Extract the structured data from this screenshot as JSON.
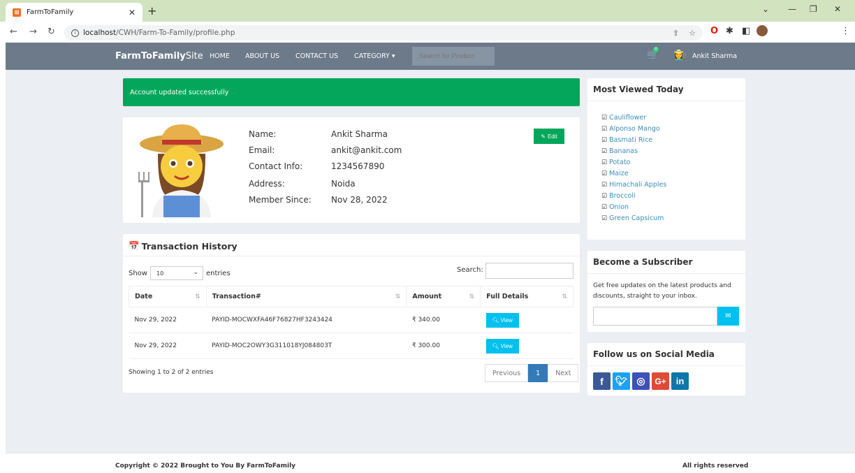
{
  "browser": {
    "tab_title": "FarmToFamily",
    "url_host": "localhost",
    "url_path": "/CWH/Farm-To-Family/profile.php"
  },
  "nav": {
    "brand_bold": "FarmToFamily",
    "brand_rest": "Site",
    "links": [
      "HOME",
      "ABOUT US",
      "CONTACT US",
      "CATEGORY ▾"
    ],
    "search_placeholder": "Search for Product",
    "cart_count": "0",
    "user_name": "Ankit Sharma"
  },
  "alert": "Account updated successfully",
  "profile": {
    "labels": [
      "Name:",
      "Email:",
      "Contact Info:",
      "Address:",
      "Member Since:"
    ],
    "values": [
      "Ankit Sharma",
      "ankit@ankit.com",
      "1234567890",
      "Noida",
      "Nov 28, 2022"
    ],
    "edit_label": "Edit"
  },
  "transactions": {
    "title": "Transaction History",
    "show_label": "Show",
    "entries_value": "10",
    "entries_label": "entries",
    "search_label": "Search:",
    "headers": [
      "Date",
      "Transaction#",
      "Amount",
      "Full Details"
    ],
    "rows": [
      {
        "date": "Nov 29, 2022",
        "id": "PAYID-MOCWXFA46F76827HF3243424",
        "amount": "₹ 340.00",
        "action": "View"
      },
      {
        "date": "Nov 29, 2022",
        "id": "PAYID-MOC2OWY3G311018YJ084803T",
        "amount": "₹ 300.00",
        "action": "View"
      }
    ],
    "showing": "Showing 1 to 2 of 2 entries",
    "pager": {
      "prev": "Previous",
      "page": "1",
      "next": "Next"
    }
  },
  "most_viewed": {
    "title": "Most Viewed Today",
    "items": [
      "Cauliflower",
      "Alponso Mango",
      "Basmati Rice",
      "Bananas",
      "Potato",
      "Maize",
      "Himachali Apples",
      "Broccoli",
      "Onion",
      "Green Capsicum"
    ]
  },
  "subscriber": {
    "title": "Become a Subscriber",
    "text": "Get free updates on the latest products and discounts, straight to your inbox."
  },
  "social": {
    "title": "Follow us on Social Media",
    "icons": [
      {
        "name": "facebook-icon",
        "glyph": "f",
        "color": "#3b5998"
      },
      {
        "name": "twitter-icon",
        "glyph": "t",
        "color": "#1da1f2"
      },
      {
        "name": "instagram-icon",
        "glyph": "◎",
        "color": "#3f51b5"
      },
      {
        "name": "google-plus-icon",
        "glyph": "G+",
        "color": "#dd4b39"
      },
      {
        "name": "linkedin-icon",
        "glyph": "in",
        "color": "#0e76a8"
      }
    ]
  },
  "footer": {
    "copyright": "Copyright © 2022 Brought to You By FarmToFamily",
    "rights": "All rights reserved"
  },
  "colors": {
    "accent_green": "#03a65a",
    "nav": "#6c7a89",
    "info": "#00c0ef",
    "link": "#3c8dbc"
  }
}
